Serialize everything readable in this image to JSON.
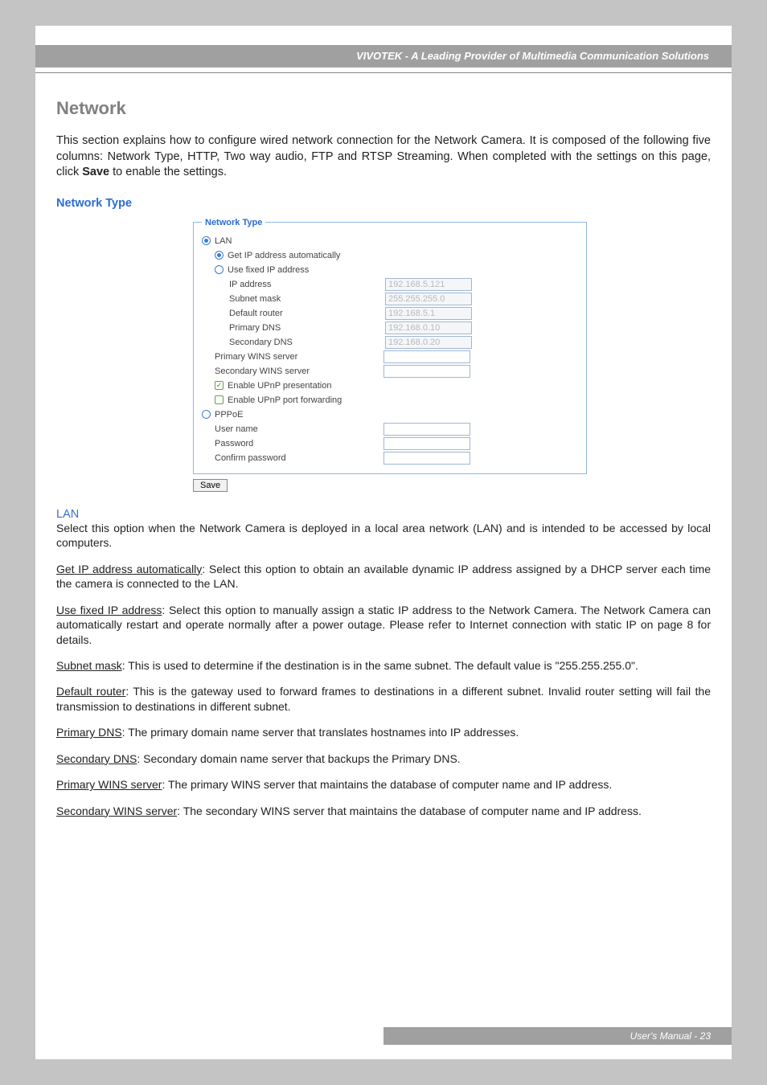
{
  "header": {
    "banner": "VIVOTEK - A Leading Provider of Multimedia Communication Solutions"
  },
  "section": {
    "title": "Network",
    "intro_a": "This section explains how to configure wired network connection for the Network Camera. It is composed of the following five columns: Network Type, HTTP, Two way audio, FTP and RTSP Streaming. When completed with the settings on this page, click ",
    "intro_bold": "Save",
    "intro_b": " to enable the settings.",
    "subhead": "Network Type"
  },
  "panel": {
    "legend": "Network Type",
    "lan_label": "LAN",
    "auto_label": "Get IP address automatically",
    "fixed_label": "Use fixed IP address",
    "fields": {
      "ip_label": "IP address",
      "ip_value": "192.168.5.121",
      "mask_label": "Subnet mask",
      "mask_value": "255.255.255.0",
      "router_label": "Default router",
      "router_value": "192.168.5.1",
      "dns1_label": "Primary DNS",
      "dns1_value": "192.168.0.10",
      "dns2_label": "Secondary DNS",
      "dns2_value": "192.168.0.20",
      "wins1_label": "Primary WINS server",
      "wins2_label": "Secondary WINS server",
      "upnp1_label": "Enable UPnP presentation",
      "upnp2_label": "Enable UPnP port forwarding"
    },
    "pppoe_label": "PPPoE",
    "pppoe": {
      "user_label": "User name",
      "pass_label": "Password",
      "confirm_label": "Confirm password"
    },
    "save_label": "Save"
  },
  "body": {
    "lan_head": "LAN",
    "lan_text": "Select this option when the Network Camera is deployed in a local area network (LAN) and is intended to be accessed by local computers.",
    "get_ip_u": "Get IP address automatically",
    "get_ip_t": ": Select this option to obtain an available dynamic IP address assigned by a DHCP server each time the camera is connected to the LAN.",
    "fixed_u": "Use fixed IP address",
    "fixed_t": ": Select this option to manually assign a static IP address to the Network Camera. The Network Camera can automatically restart and operate normally after a power outage. Please refer to Internet connection with static IP on page 8 for details.",
    "mask_u": "Subnet mask",
    "mask_t": ": This is used to determine if the destination is in the same subnet. The default value is \"255.255.255.0\".",
    "router_u": "Default router",
    "router_t": ": This is the gateway used to forward frames to destinations in a different subnet. Invalid router setting will fail the transmission to destinations in different subnet.",
    "dns1_u": "Primary DNS",
    "dns1_t": ": The primary domain name server that translates hostnames into IP addresses.",
    "dns2_u": "Secondary DNS",
    "dns2_t": ": Secondary domain name server that backups the Primary DNS.",
    "wins1_u": "Primary WINS server",
    "wins1_t": ": The primary WINS server that maintains the database of computer name and IP address.",
    "wins2_u": "Secondary WINS server",
    "wins2_t": ": The secondary WINS server that maintains the database of computer name and IP address."
  },
  "footer": {
    "text": "User's Manual - 23"
  }
}
